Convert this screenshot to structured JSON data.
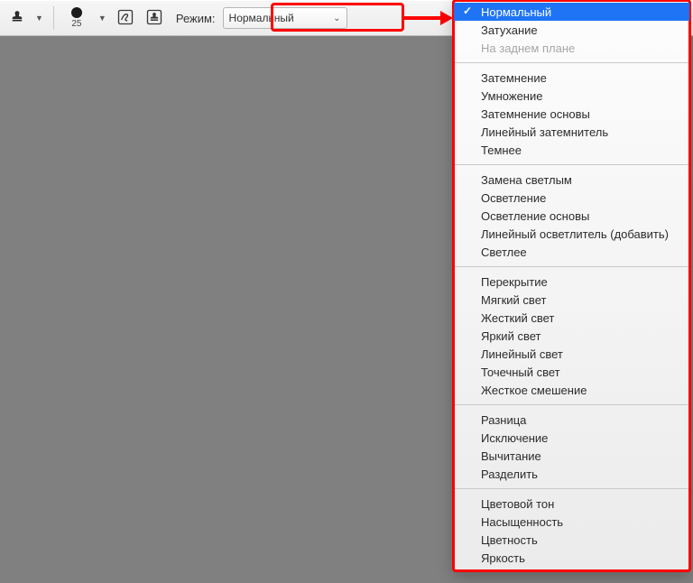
{
  "toolbar": {
    "brush_size": "25",
    "mode_label": "Режим:",
    "mode_value": "Нормальный"
  },
  "menu": {
    "groups": [
      {
        "items": [
          {
            "label": "Нормальный",
            "selected": true,
            "disabled": false
          },
          {
            "label": "Затухание",
            "selected": false,
            "disabled": false
          },
          {
            "label": "На заднем плане",
            "selected": false,
            "disabled": true
          }
        ]
      },
      {
        "items": [
          {
            "label": "Затемнение"
          },
          {
            "label": "Умножение"
          },
          {
            "label": "Затемнение основы"
          },
          {
            "label": "Линейный затемнитель"
          },
          {
            "label": "Темнее"
          }
        ]
      },
      {
        "items": [
          {
            "label": "Замена светлым"
          },
          {
            "label": "Осветление"
          },
          {
            "label": "Осветление основы"
          },
          {
            "label": "Линейный осветлитель (добавить)"
          },
          {
            "label": "Светлее"
          }
        ]
      },
      {
        "items": [
          {
            "label": "Перекрытие"
          },
          {
            "label": "Мягкий свет"
          },
          {
            "label": "Жесткий свет"
          },
          {
            "label": "Яркий свет"
          },
          {
            "label": "Линейный свет"
          },
          {
            "label": "Точечный свет"
          },
          {
            "label": "Жесткое смешение"
          }
        ]
      },
      {
        "items": [
          {
            "label": "Разница"
          },
          {
            "label": "Исключение"
          },
          {
            "label": "Вычитание"
          },
          {
            "label": "Разделить"
          }
        ]
      },
      {
        "items": [
          {
            "label": "Цветовой тон"
          },
          {
            "label": "Насыщенность"
          },
          {
            "label": "Цветность"
          },
          {
            "label": "Яркость"
          }
        ]
      }
    ]
  },
  "annotation": {
    "color": "#ff0000"
  }
}
